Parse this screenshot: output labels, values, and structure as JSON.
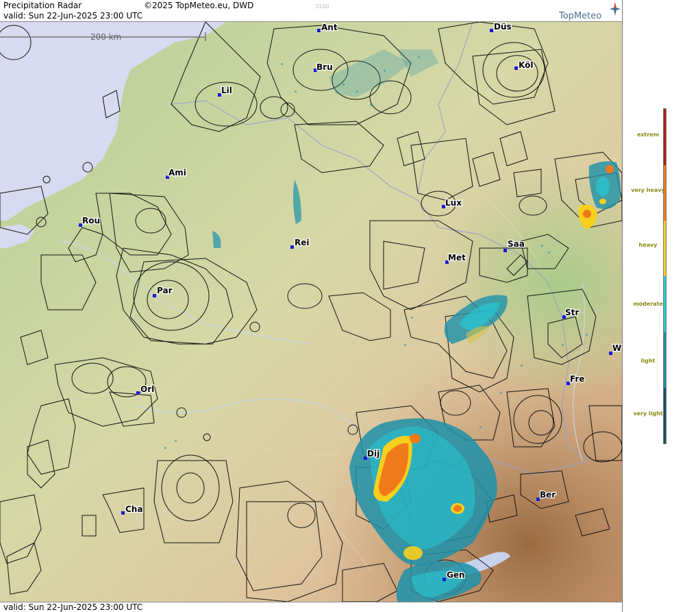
{
  "header": {
    "title": "Precipitation Radar",
    "copyright": "©2025 TopMeteo.eu, DWD",
    "code": "3100",
    "valid": "valid:  Sun  22-Jun-2025 23:00 UTC",
    "logo": "TopMeteo"
  },
  "footer": {
    "valid": "valid:  Sun  22-Jun-2025 23:00 UTC"
  },
  "scale": {
    "label": "200 km"
  },
  "legend": {
    "items": [
      {
        "label": "extrem",
        "color": "#b31b10"
      },
      {
        "label": "very heavy",
        "color": "#ef7a1a"
      },
      {
        "label": "heavy",
        "color": "#f7d01d"
      },
      {
        "label": "moderate",
        "color": "#27c8d6"
      },
      {
        "label": "light",
        "color": "#1d91a9"
      },
      {
        "label": "very light",
        "color": "#164d68"
      }
    ]
  },
  "cities": [
    {
      "id": "ant",
      "label": "Ant"
    },
    {
      "id": "dus",
      "label": "Düs"
    },
    {
      "id": "bru",
      "label": "Bru"
    },
    {
      "id": "kol",
      "label": "Köl"
    },
    {
      "id": "lil",
      "label": "Lil"
    },
    {
      "id": "ami",
      "label": "Ami"
    },
    {
      "id": "rou",
      "label": "Rou"
    },
    {
      "id": "lux",
      "label": "Lux"
    },
    {
      "id": "rei",
      "label": "Rei"
    },
    {
      "id": "saa",
      "label": "Saa"
    },
    {
      "id": "met",
      "label": "Met"
    },
    {
      "id": "par",
      "label": "Par"
    },
    {
      "id": "str",
      "label": "Str"
    },
    {
      "id": "w",
      "label": "W"
    },
    {
      "id": "fre",
      "label": "Fre"
    },
    {
      "id": "orl",
      "label": "Orl"
    },
    {
      "id": "dij",
      "label": "Dij"
    },
    {
      "id": "ber",
      "label": "Ber"
    },
    {
      "id": "cha",
      "label": "Cha"
    },
    {
      "id": "gen",
      "label": "Gen"
    }
  ]
}
